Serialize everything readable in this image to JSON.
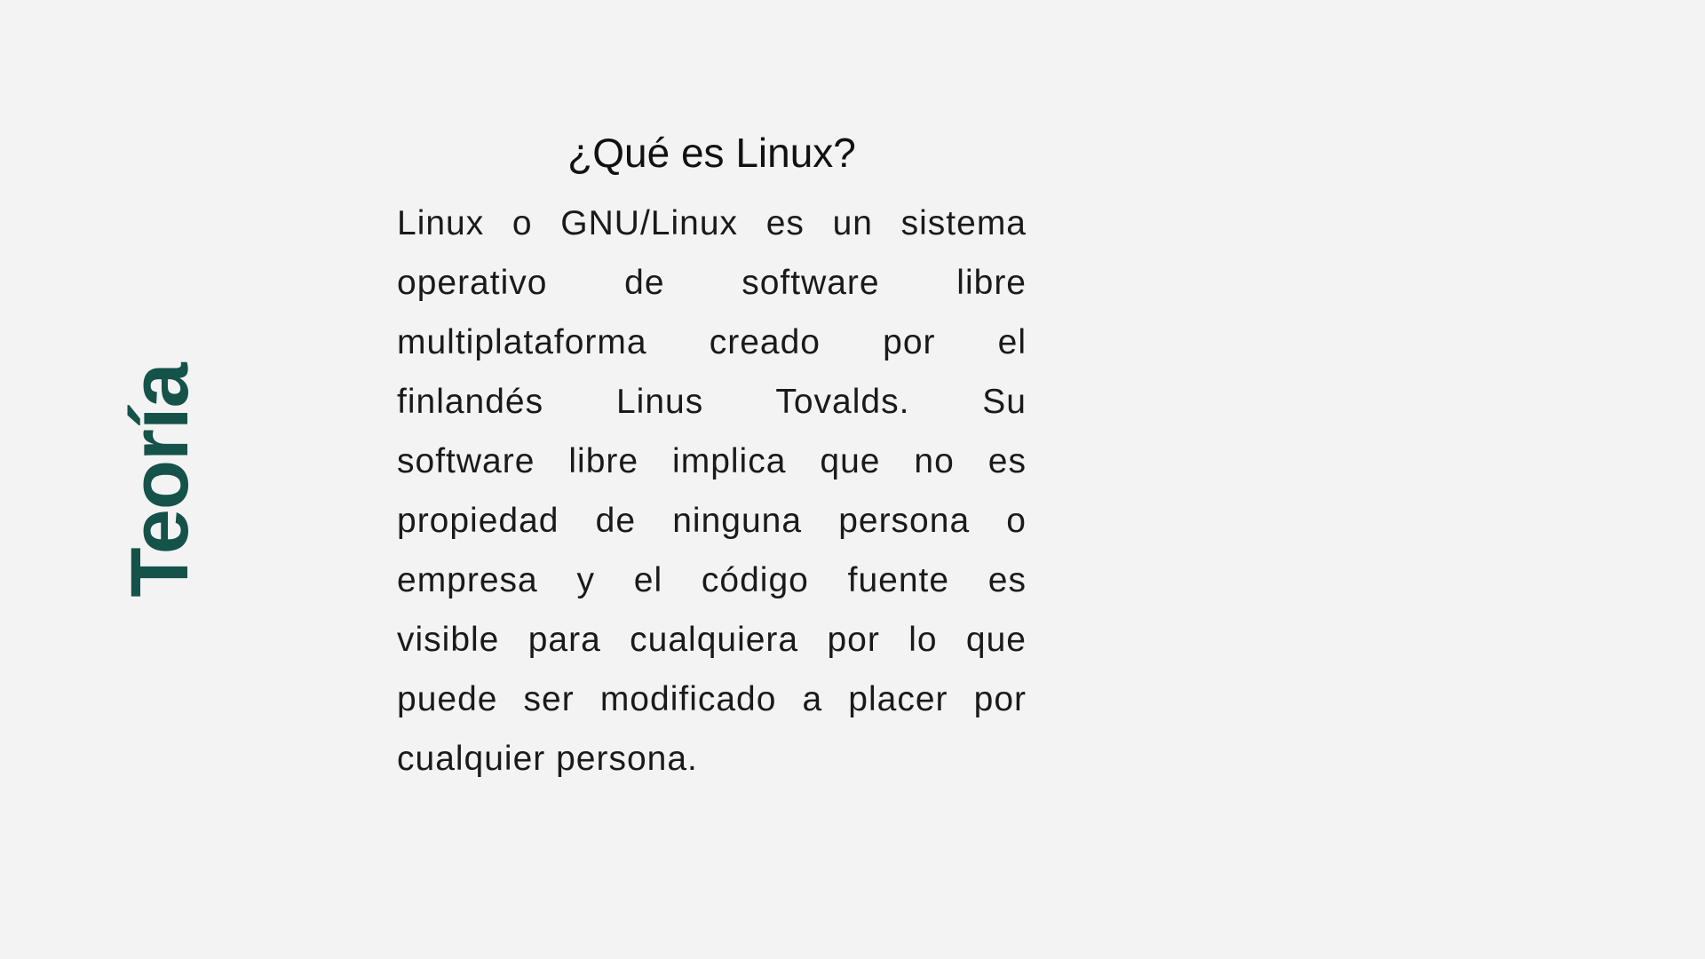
{
  "side_label": "Teoría",
  "title": "¿Qué es Linux?",
  "body_lines": [
    "Linux o GNU/Linux es un sistema",
    "operativo de software libre",
    "multiplataforma creado por el",
    "finlandés Linus Tovalds. Su",
    "software libre implica que no es",
    "propiedad de ninguna persona o",
    "empresa y el código fuente es",
    "visible para cualquiera por lo que",
    "puede ser modificado a placer por",
    "cualquier persona."
  ],
  "colors": {
    "accent": "#14524a",
    "background": "#f3f3f3",
    "text": "#1a1a1a"
  }
}
